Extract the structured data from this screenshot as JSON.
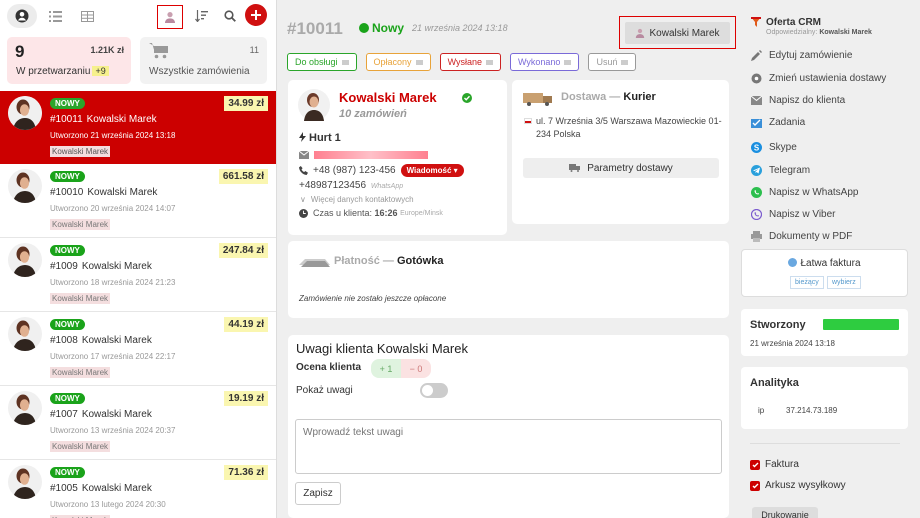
{
  "sidebar": {
    "stats": {
      "processing": {
        "count": "9",
        "amount": "1.21K zł",
        "label": "W przetwarzaniu",
        "badge": "+9"
      },
      "all": {
        "count": "11",
        "label": "Wszystkie zamówienia"
      }
    },
    "orders": [
      {
        "status": "NOWY",
        "amount": "34.99 zł",
        "id": "#10011",
        "name": "Kowalski Marek",
        "created": "Utworzono 21 września 2024 13:18",
        "tag": "Kowalski Marek"
      },
      {
        "status": "NOWY",
        "amount": "661.58 zł",
        "id": "#10010",
        "name": "Kowalski Marek",
        "created": "Utworzono 20 września 2024 14:07",
        "tag": "Kowalski Marek"
      },
      {
        "status": "NOWY",
        "amount": "247.84 zł",
        "id": "#1009",
        "name": "Kowalski Marek",
        "created": "Utworzono 18 września 2024 21:23",
        "tag": "Kowalski Marek"
      },
      {
        "status": "NOWY",
        "amount": "44.19 zł",
        "id": "#1008",
        "name": "Kowalski Marek",
        "created": "Utworzono 17 września 2024 22:17",
        "tag": "Kowalski Marek"
      },
      {
        "status": "NOWY",
        "amount": "19.19 zł",
        "id": "#1007",
        "name": "Kowalski Marek",
        "created": "Utworzono 13 września 2024 20:37",
        "tag": "Kowalski Marek"
      },
      {
        "status": "NOWY",
        "amount": "71.36 zł",
        "id": "#1005",
        "name": "Kowalski Marek",
        "created": "Utworzono 13 lutego 2024 20:30",
        "tag": "Kowalski Marek"
      }
    ]
  },
  "order": {
    "number": "#10011",
    "status": "Nowy",
    "datetime": "21 września 2024 13:18",
    "manager": "Kowalski Marek",
    "status_buttons": [
      {
        "label": "Do obsługi",
        "color": "#2aa52a"
      },
      {
        "label": "Opłacony",
        "color": "#e8a33a"
      },
      {
        "label": "Wysłane",
        "color": "#cc2222"
      },
      {
        "label": "Wykonano",
        "color": "#7a6ad8"
      },
      {
        "label": "Usuń",
        "color": "#999999"
      }
    ]
  },
  "customer": {
    "name": "Kowalski Marek",
    "orders_count": "10 zamówień",
    "group": "Hurt 1",
    "phone": "+48 (987) 123-456",
    "message_btn": "Wiadomość",
    "whatsapp_phone": "+48987123456",
    "whatsapp_label": "WhatsApp",
    "more_contacts": "Więcej danych kontaktowych",
    "client_time_label": "Czas u klienta:",
    "client_time": "16:26",
    "timezone": "Europe/Minsk"
  },
  "delivery": {
    "label": "Dostawa",
    "method": "Kurier",
    "address": "ul. 7 Września 3/5 Warszawa Mazowieckie 01-234 Polska",
    "params_btn": "Parametry dostawy"
  },
  "payment": {
    "label": "Płatność",
    "method": "Gotówka",
    "note": "Zamówienie nie zostało jeszcze opłacone"
  },
  "notes": {
    "title": "Uwagi klienta Kowalski Marek",
    "rating_label": "Ocena klienta",
    "plus": "+ 1",
    "minus": "− 0",
    "show_label": "Pokaż uwagi",
    "placeholder": "Wprowadź tekst uwagi",
    "save_btn": "Zapisz"
  },
  "right": {
    "crm_title": "Oferta CRM",
    "responsible_label": "Odpowiedzialny:",
    "responsible": "Kowalski Marek",
    "actions": [
      "Edytuj zamówienie",
      "Zmień ustawienia dostawy",
      "Napisz do klienta",
      "Zadania",
      "Skype",
      "Telegram",
      "Napisz w WhatsApp",
      "Napisz w Viber",
      "Dokumenty w PDF"
    ],
    "invoice_title": "Łatwa faktura",
    "invoice_current": "bieżący",
    "invoice_choose": "wybierz",
    "created_title": "Stworzony",
    "created_date": "21 września 2024 13:18",
    "analytics_title": "Analityka",
    "ip_label": "ip",
    "ip": "37.214.73.189",
    "check1": "Faktura",
    "check2": "Arkusz wysyłkowy",
    "print_btn": "Drukowanie"
  }
}
